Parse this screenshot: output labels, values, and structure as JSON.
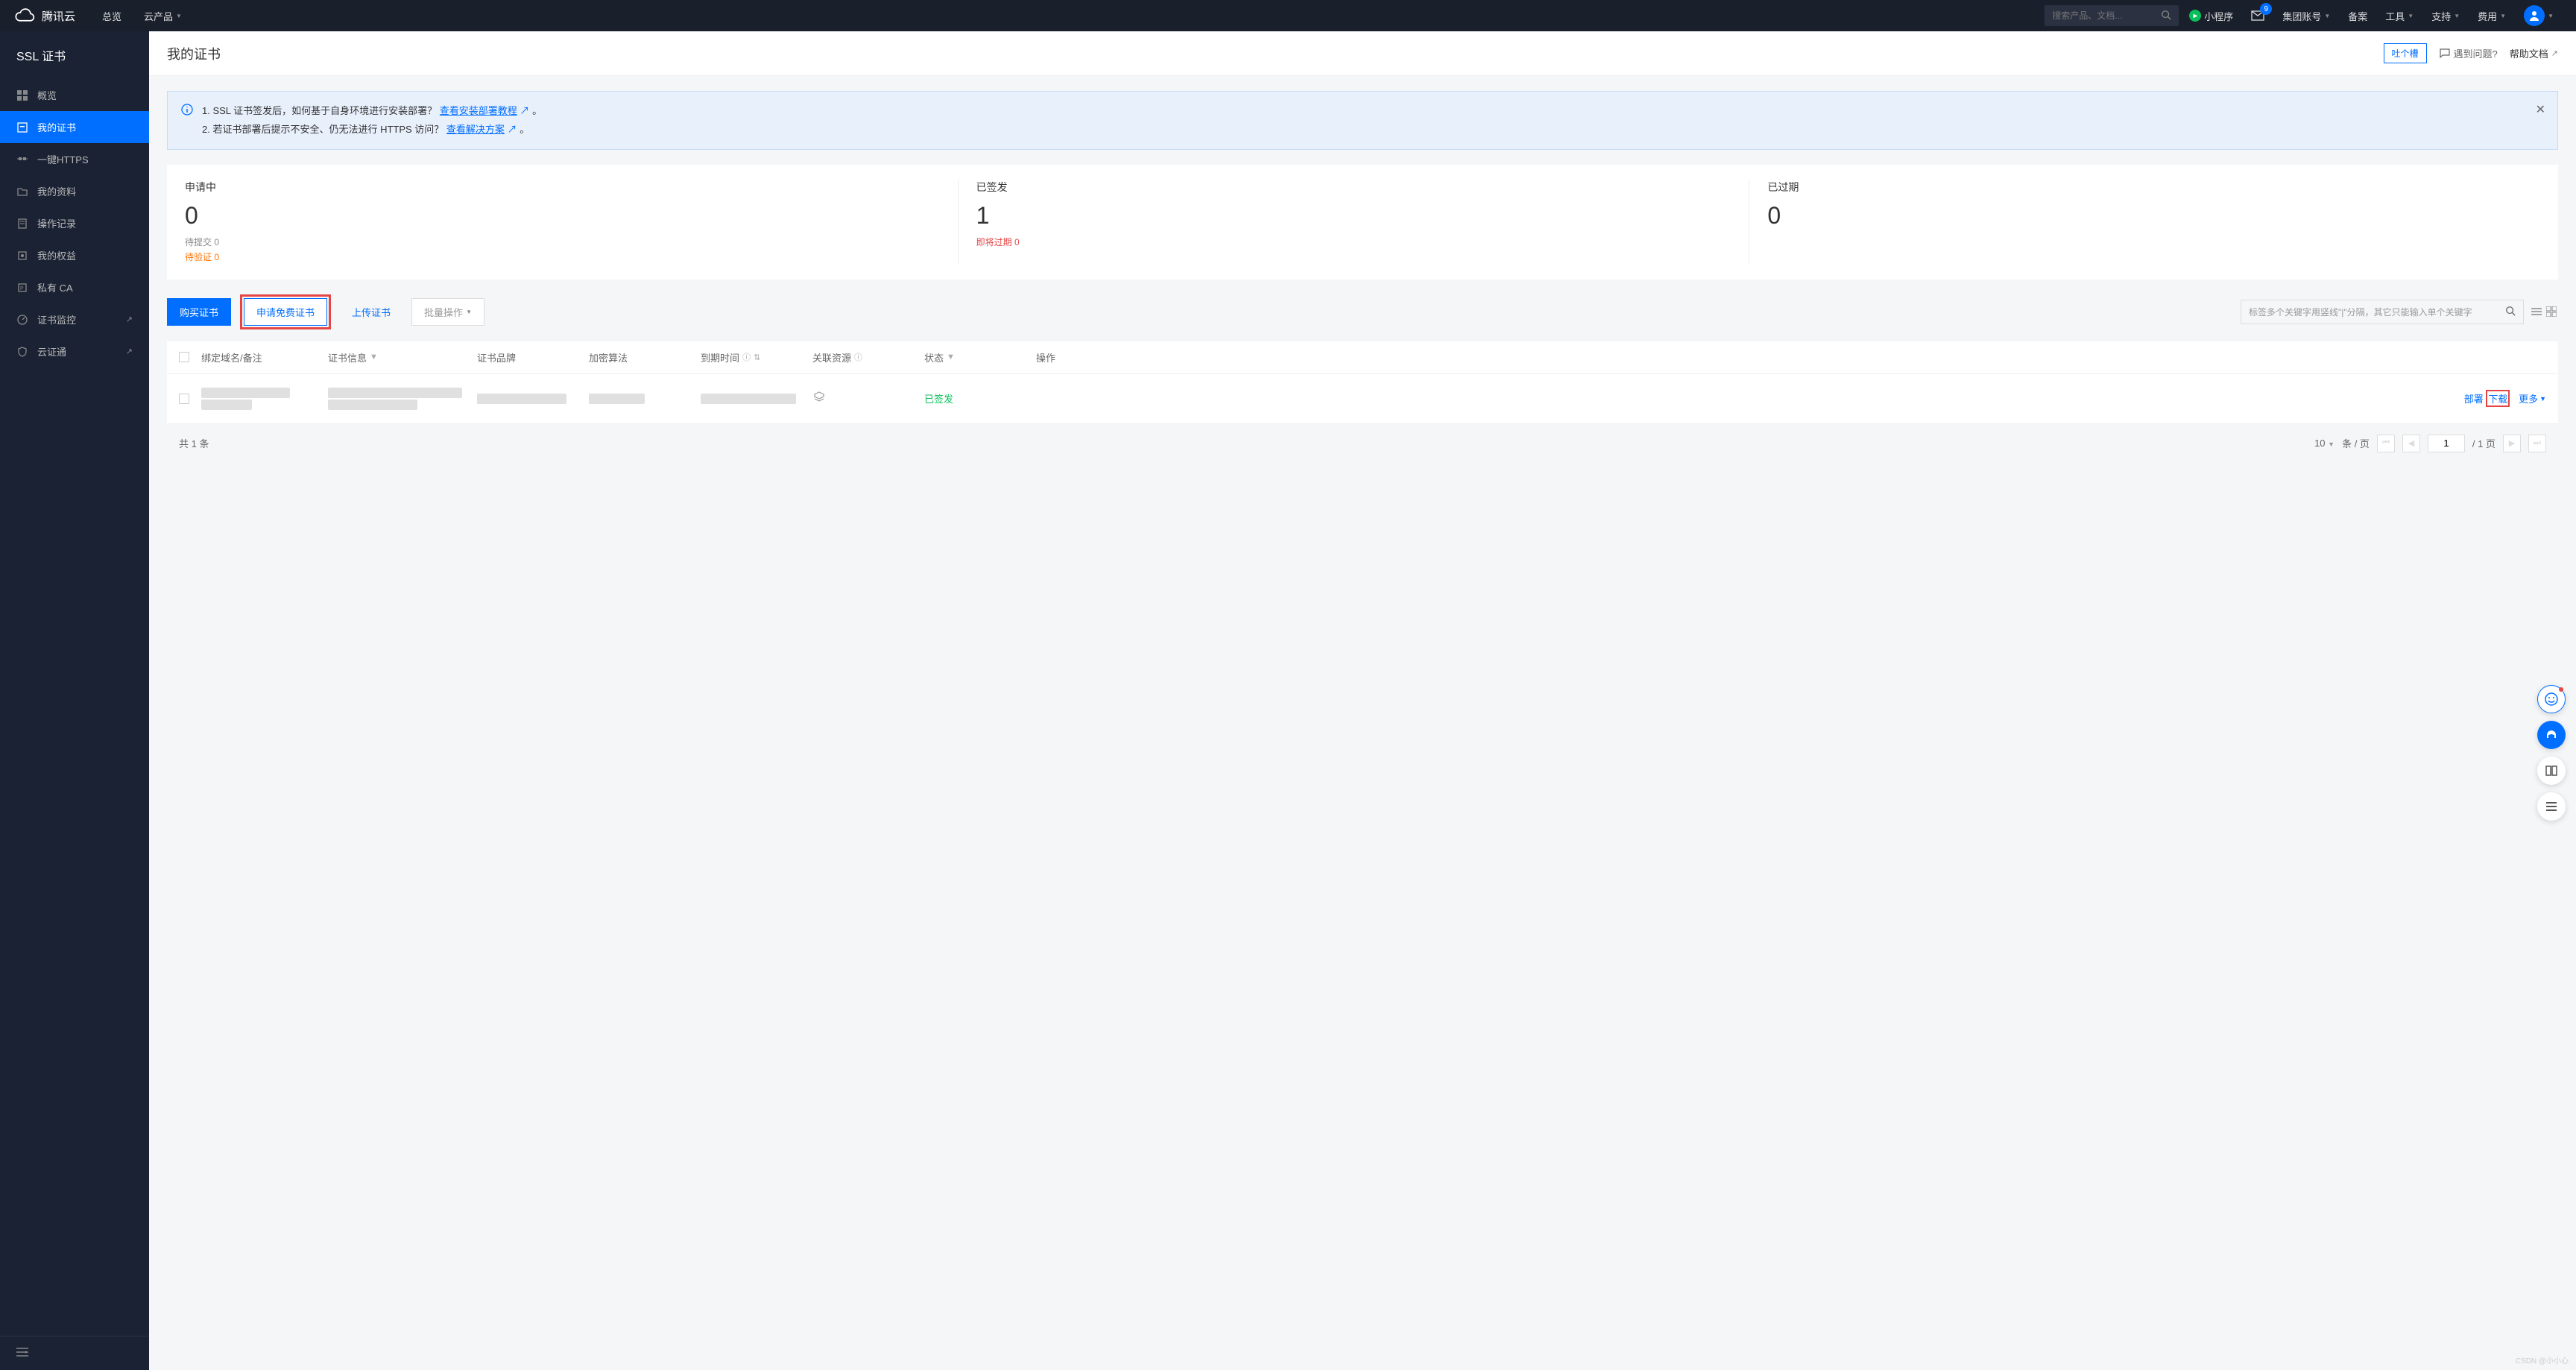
{
  "header": {
    "brand": "腾讯云",
    "nav": {
      "overview": "总览",
      "products": "云产品"
    },
    "search_placeholder": "搜索产品、文档...",
    "miniprog": "小程序",
    "mail_badge": "9",
    "account": "集团账号",
    "filing": "备案",
    "tools": "工具",
    "support": "支持",
    "fees": "费用"
  },
  "sidebar": {
    "title": "SSL 证书",
    "items": {
      "overview": "概览",
      "mycert": "我的证书",
      "onekey": "一键HTTPS",
      "profile": "我的资料",
      "oplog": "操作记录",
      "rights": "我的权益",
      "pca": "私有 CA",
      "monitor": "证书监控",
      "yzt": "云证通"
    }
  },
  "page": {
    "title": "我的证书",
    "feedback": "吐个槽",
    "faq": "遇到问题?",
    "docs": "帮助文档"
  },
  "notice": {
    "line1_prefix": "1. SSL 证书签发后，如何基于自身环境进行安装部署？",
    "line1_link": "查看安装部署教程",
    "line1_suffix": "。",
    "line2_prefix": "2. 若证书部署后提示不安全、仍无法进行 HTTPS 访问？",
    "line2_link": "查看解决方案",
    "line2_suffix": "。"
  },
  "stats": {
    "pending": {
      "label": "申请中",
      "value": "0",
      "sub1": "待提交 0",
      "sub2": "待验证 0"
    },
    "issued": {
      "label": "已签发",
      "value": "1",
      "sub1": "即将过期 0"
    },
    "expired": {
      "label": "已过期",
      "value": "0",
      "sub1": ""
    }
  },
  "actions": {
    "buy": "购买证书",
    "free": "申请免费证书",
    "upload": "上传证书",
    "batch": "批量操作",
    "filter_placeholder": "标签多个关键字用竖线\"|\"分隔，其它只能输入单个关键字"
  },
  "table": {
    "cols": {
      "domain": "绑定域名/备注",
      "info": "证书信息",
      "brand": "证书品牌",
      "algo": "加密算法",
      "expire": "到期时间",
      "resource": "关联资源",
      "status": "状态",
      "op": "操作"
    },
    "row": {
      "status": "已签发",
      "deploy": "部署",
      "download": "下载",
      "more": "更多"
    }
  },
  "pagination": {
    "total_prefix": "共",
    "total_count": "1",
    "total_suffix": "条",
    "page_size": "10",
    "per_page": "条 / 页",
    "current": "1",
    "of": "/ 1 页"
  },
  "watermark": "CSDN @小小心"
}
